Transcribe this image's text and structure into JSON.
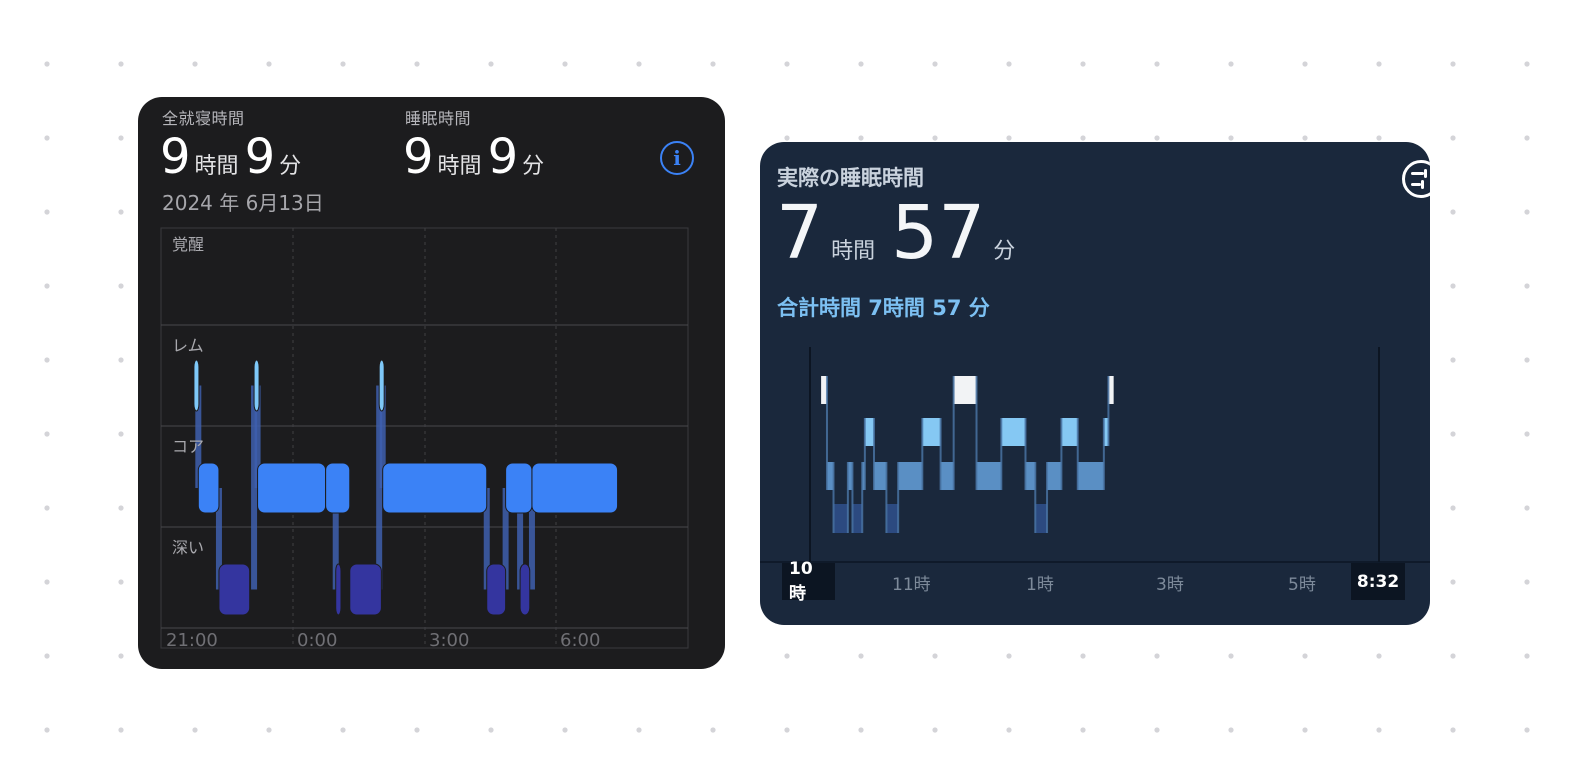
{
  "left_card": {
    "in_bed_label": "全就寝時間",
    "in_bed_hours": "9",
    "in_bed_hours_unit": "時間",
    "in_bed_minutes": "9",
    "in_bed_minutes_unit": "分",
    "asleep_label": "睡眠時間",
    "asleep_hours": "9",
    "asleep_hours_unit": "時間",
    "asleep_minutes": "9",
    "asleep_minutes_unit": "分",
    "date": "2024 年 6月13日",
    "info_icon": "info-icon",
    "stage_labels": {
      "awake": "覚醒",
      "rem": "レム",
      "core": "コア",
      "deep": "深い"
    },
    "x_labels": [
      "21:00",
      "0:00",
      "3:00",
      "6:00"
    ],
    "colors": {
      "rem": "#7ec8f8",
      "core": "#3b82f6",
      "deep": "#34359f",
      "connector": "#3e5fae"
    }
  },
  "right_card": {
    "title": "実際の睡眠時間",
    "hours": "7",
    "hours_unit": "時間",
    "minutes": "57",
    "minutes_unit": "分",
    "total_text": "合計時間 7時間 57 分",
    "settings_icon": "sliders-icon",
    "start_tag": "10時",
    "end_tag": "8:32",
    "x_labels": [
      "11時",
      "1時",
      "3時",
      "5時"
    ],
    "colors": {
      "awake": "#f2f3f5",
      "rem": "#85c8f3",
      "light": "#5a8fc4",
      "deep": "#2c4a80"
    }
  },
  "chart_data": [
    {
      "type": "timeline",
      "chart": "sleep-stages-left",
      "categories": [
        "覚醒",
        "レム",
        "コア",
        "深い"
      ],
      "x_ticks": [
        "21:00",
        "0:00",
        "3:00",
        "6:00"
      ],
      "x_unit": "hours after 21:00",
      "segments": [
        {
          "stage": "レム",
          "start": 0.75,
          "end": 0.85
        },
        {
          "stage": "コア",
          "start": 0.85,
          "end": 1.32
        },
        {
          "stage": "深い",
          "start": 1.32,
          "end": 2.02
        },
        {
          "stage": "レム",
          "start": 2.12,
          "end": 2.2
        },
        {
          "stage": "コア",
          "start": 2.2,
          "end": 3.75
        },
        {
          "stage": "コア",
          "start": 3.75,
          "end": 4.3
        },
        {
          "stage": "深い",
          "start": 3.98,
          "end": 4.1
        },
        {
          "stage": "深い",
          "start": 4.3,
          "end": 5.02
        },
        {
          "stage": "レム",
          "start": 4.97,
          "end": 5.05
        },
        {
          "stage": "コア",
          "start": 5.05,
          "end": 7.42
        },
        {
          "stage": "深い",
          "start": 7.42,
          "end": 7.85
        },
        {
          "stage": "コア",
          "start": 7.85,
          "end": 8.45
        },
        {
          "stage": "深い",
          "start": 8.18,
          "end": 8.4
        },
        {
          "stage": "コア",
          "start": 8.45,
          "end": 10.4
        }
      ]
    },
    {
      "type": "timeline",
      "chart": "sleep-stages-right",
      "categories": [
        "awake",
        "rem",
        "light",
        "deep"
      ],
      "x_ticks": [
        "10時",
        "11時",
        "1時",
        "3時",
        "5時",
        "8:32"
      ],
      "x_unit": "hours after 22:00",
      "segments": [
        {
          "stage": "awake",
          "start": 0.17,
          "end": 0.26
        },
        {
          "stage": "light",
          "start": 0.26,
          "end": 0.36
        },
        {
          "stage": "deep",
          "start": 0.36,
          "end": 0.58
        },
        {
          "stage": "light",
          "start": 0.58,
          "end": 0.65
        },
        {
          "stage": "deep",
          "start": 0.65,
          "end": 0.8
        },
        {
          "stage": "light",
          "start": 0.8,
          "end": 0.84
        },
        {
          "stage": "rem",
          "start": 0.84,
          "end": 0.98
        },
        {
          "stage": "light",
          "start": 0.98,
          "end": 1.17
        },
        {
          "stage": "deep",
          "start": 1.17,
          "end": 1.35
        },
        {
          "stage": "light",
          "start": 1.35,
          "end": 1.72
        },
        {
          "stage": "rem",
          "start": 1.72,
          "end": 2.0
        },
        {
          "stage": "light",
          "start": 2.0,
          "end": 2.2
        },
        {
          "stage": "awake",
          "start": 2.2,
          "end": 2.55
        },
        {
          "stage": "light",
          "start": 2.55,
          "end": 2.93
        },
        {
          "stage": "rem",
          "start": 2.93,
          "end": 3.3
        },
        {
          "stage": "light",
          "start": 3.3,
          "end": 3.45
        },
        {
          "stage": "deep",
          "start": 3.45,
          "end": 3.63
        },
        {
          "stage": "light",
          "start": 3.63,
          "end": 3.85
        },
        {
          "stage": "rem",
          "start": 3.85,
          "end": 4.1
        },
        {
          "stage": "light",
          "start": 4.1,
          "end": 4.5
        },
        {
          "stage": "rem",
          "start": 4.5,
          "end": 4.57
        },
        {
          "stage": "awake",
          "start": 4.57,
          "end": 4.65
        }
      ]
    }
  ]
}
